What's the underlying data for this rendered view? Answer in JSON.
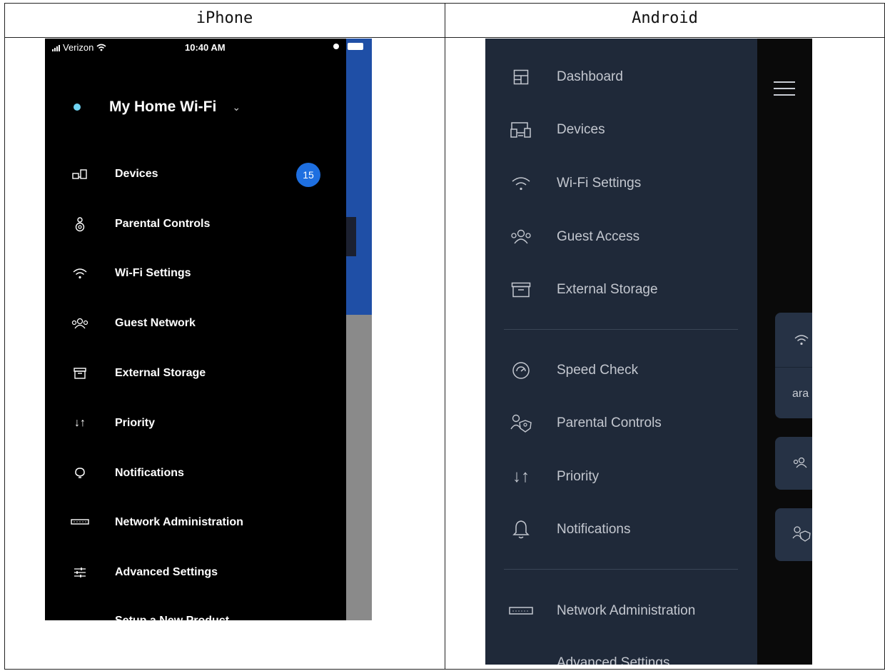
{
  "columns": {
    "left": "iPhone",
    "right": "Android"
  },
  "iphone": {
    "status": {
      "carrier": "Verizon",
      "time": "10:40 AM"
    },
    "network_name": "My Home Wi-Fi",
    "menu": [
      {
        "label": "Devices",
        "icon": "devices-icon",
        "badge": "15"
      },
      {
        "label": "Parental Controls",
        "icon": "parental-controls-icon"
      },
      {
        "label": "Wi-Fi Settings",
        "icon": "wifi-icon"
      },
      {
        "label": "Guest Network",
        "icon": "guest-icon"
      },
      {
        "label": "External Storage",
        "icon": "storage-icon"
      },
      {
        "label": "Priority",
        "icon": "priority-icon"
      },
      {
        "label": "Notifications",
        "icon": "notifications-icon"
      },
      {
        "label": "Network Administration",
        "icon": "network-admin-icon"
      },
      {
        "label": "Advanced Settings",
        "icon": "advanced-settings-icon"
      }
    ],
    "partial_item": "Setup a New Product"
  },
  "android": {
    "menu": [
      {
        "label": "Dashboard",
        "icon": "dashboard-icon"
      },
      {
        "label": "Devices",
        "icon": "devices-icon"
      },
      {
        "label": "Wi-Fi Settings",
        "icon": "wifi-icon"
      },
      {
        "label": "Guest Access",
        "icon": "guest-icon"
      },
      {
        "label": "External Storage",
        "icon": "storage-icon"
      },
      {
        "label": "Speed Check",
        "icon": "speed-check-icon"
      },
      {
        "label": "Parental Controls",
        "icon": "parental-controls-icon"
      },
      {
        "label": "Priority",
        "icon": "priority-icon"
      },
      {
        "label": "Notifications",
        "icon": "notifications-icon"
      },
      {
        "label": "Network Administration",
        "icon": "network-admin-icon"
      }
    ],
    "partial_item": "Advanced Settings",
    "card_text": "ara"
  },
  "colors": {
    "iphone_drawer": "#000000",
    "android_drawer": "#1f2939",
    "badge": "#1e6fe0",
    "status_dot": "#6fd3f2"
  }
}
